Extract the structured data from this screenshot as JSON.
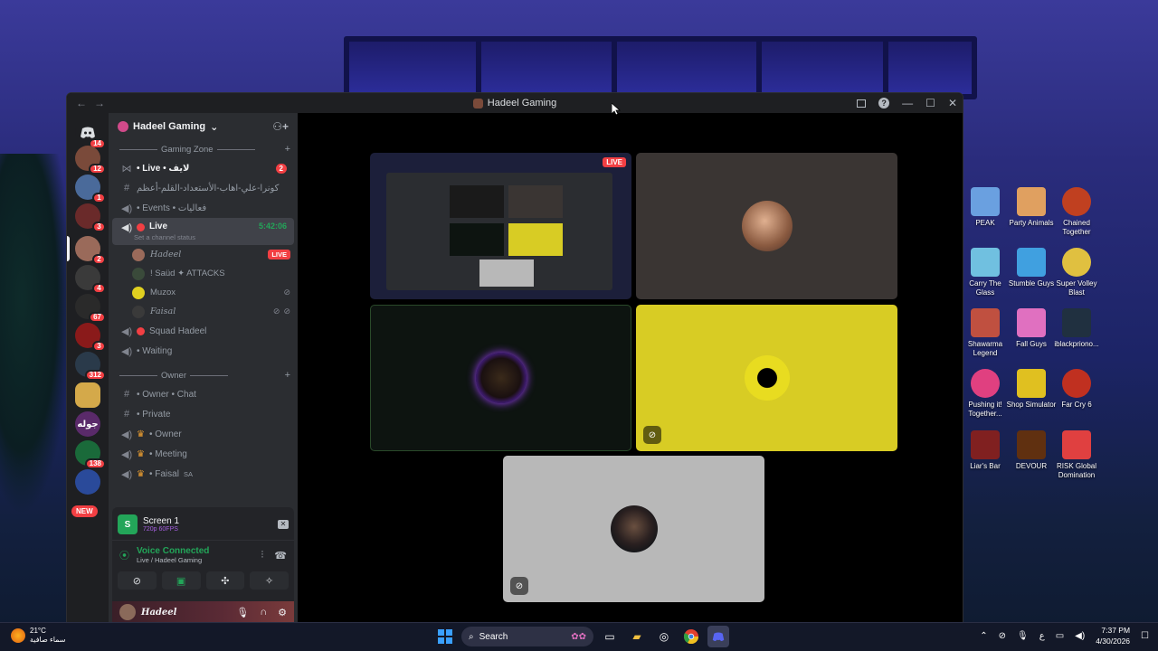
{
  "window": {
    "title": "Hadeel Gaming",
    "nav_back": "←",
    "nav_forward": "→",
    "help": "?",
    "minimize": "—",
    "maximize": "☐",
    "close": "✕"
  },
  "rail": {
    "servers": [
      {
        "badge": "14",
        "color": "#1e1f22"
      },
      {
        "badge": "12",
        "color": "#7a4a3a"
      },
      {
        "badge": "1",
        "color": "#4a6a9a"
      },
      {
        "badge": "3",
        "color": "#6a2a2a"
      },
      {
        "badge": "2",
        "color": "#9a6a5a"
      },
      {
        "badge": "4",
        "color": "#3a3a3a"
      },
      {
        "badge": "67",
        "color": "#2a2a2a"
      },
      {
        "badge": "3",
        "color": "#8a1a1a"
      },
      {
        "badge": "312",
        "color": "#2a3a4a"
      },
      {
        "badge": "",
        "color": "#d4a94a"
      },
      {
        "badge": "",
        "color": "#5a2a6a",
        "label": "جوله"
      },
      {
        "badge": "138",
        "color": "#1a6a3a"
      },
      {
        "badge": "",
        "color": "#2a4a9a"
      }
    ],
    "new_label": "NEW"
  },
  "sidebar": {
    "server_name": "Hadeel Gaming",
    "categories": {
      "gaming_zone": "Gaming Zone",
      "owner": "Owner"
    },
    "channels": {
      "live_ar": {
        "label": "• Live • لايف",
        "badge": "2"
      },
      "rules_ar": {
        "label": "كونرا-علي-اهاب-الأستعداد-القلم-أعظم"
      },
      "events": {
        "label": "• Events • فعاليات"
      },
      "live": {
        "label": "Live",
        "timer": "5:42:06",
        "status": "Set a channel status"
      },
      "squad": {
        "label": "Squad Hadeel"
      },
      "waiting": {
        "label": "• Waiting"
      },
      "owner_chat": {
        "label": "• Owner • Chat"
      },
      "private": {
        "label": "• Private"
      },
      "owner": {
        "label": "• Owner"
      },
      "meeting": {
        "label": "• Meeting"
      },
      "faisal": {
        "label": "• Faisal",
        "suffix": "SA"
      }
    },
    "live_users": [
      {
        "name": "Hadeel",
        "tag": "LIVE",
        "color": "#9a6a5a"
      },
      {
        "name": "! Saüd ✦ ATTACKS",
        "tag": "",
        "color": "#3a4a3a"
      },
      {
        "name": "Muzox",
        "tag": "",
        "color": "#e0d020"
      },
      {
        "name": "Faisal",
        "tag": "",
        "color": "#3a3a3a"
      }
    ]
  },
  "voice_panel": {
    "screen_title": "Screen 1",
    "screen_quality": "720p 60FPS",
    "status": "Voice Connected",
    "channel": "Live / Hadeel Gaming",
    "user_name": "Hadeel"
  },
  "stage": {
    "live_tag": "LIVE",
    "tiles": [
      {
        "name": "Hadeel",
        "bg": "#3a3533"
      },
      {
        "name": "Saud",
        "bg": "#0d1410"
      },
      {
        "name": "Muzox",
        "bg": "#d8cc24"
      },
      {
        "name": "Faisal",
        "bg": "#b8b8b8"
      }
    ]
  },
  "desktop_icons": [
    {
      "label": "PEAK",
      "color": "#6aa0e0"
    },
    {
      "label": "Party Animals",
      "color": "#e0a060"
    },
    {
      "label": "Chained Together",
      "color": "#c04020"
    },
    {
      "label": "Carry The Glass",
      "color": "#70c0e0"
    },
    {
      "label": "Stumble Guys",
      "color": "#40a0e0"
    },
    {
      "label": "Super Volley Blast",
      "color": "#e0c040"
    },
    {
      "label": "Shawarma Legend",
      "color": "#c05040"
    },
    {
      "label": "Fall Guys",
      "color": "#e070c0"
    },
    {
      "label": "iblackpriono...",
      "color": "#203040"
    },
    {
      "label": "Pushing it! Together...",
      "color": "#e04080"
    },
    {
      "label": "Shop Simulator",
      "color": "#e0c020"
    },
    {
      "label": "Far Cry 6",
      "color": "#c03020"
    },
    {
      "label": "Liar's Bar",
      "color": "#802020"
    },
    {
      "label": "DEVOUR",
      "color": "#603010"
    },
    {
      "label": "RISK Global Domination",
      "color": "#e04040"
    }
  ],
  "taskbar": {
    "temperature": "21°C",
    "weather": "سماء صافية",
    "search_placeholder": "Search",
    "time": "7:37 PM",
    "date": "4/30/2026",
    "lang": "ع"
  }
}
